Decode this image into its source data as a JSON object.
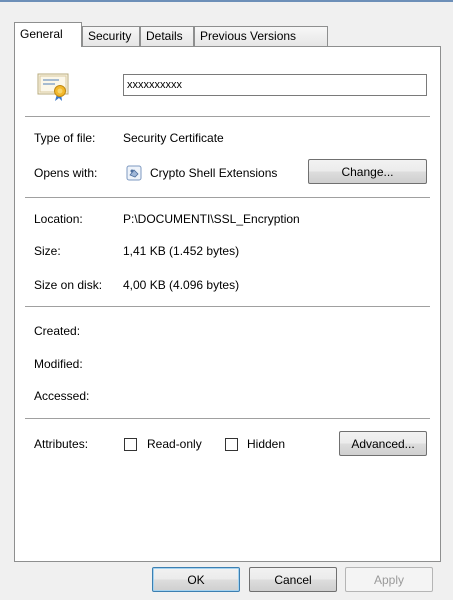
{
  "tabs": [
    {
      "label": "General"
    },
    {
      "label": "Security"
    },
    {
      "label": "Details"
    },
    {
      "label": "Previous Versions"
    }
  ],
  "file_name": "xxxxxxxxxx",
  "type_of_file": {
    "label": "Type of file:",
    "value": "Security Certificate"
  },
  "opens_with": {
    "label": "Opens with:",
    "value": "Crypto Shell Extensions",
    "button": "Change..."
  },
  "location": {
    "label": "Location:",
    "value": "P:\\DOCUMENTI\\SSL_Encryption"
  },
  "size": {
    "label": "Size:",
    "value": "1,41 KB (1.452 bytes)"
  },
  "size_on_disk": {
    "label": "Size on disk:",
    "value": "4,00 KB (4.096 bytes)"
  },
  "created": {
    "label": "Created:",
    "value": ""
  },
  "modified": {
    "label": "Modified:",
    "value": ""
  },
  "accessed": {
    "label": "Accessed:",
    "value": ""
  },
  "attributes": {
    "label": "Attributes:",
    "read_only": {
      "label": "Read-only",
      "checked": false
    },
    "hidden": {
      "label": "Hidden",
      "checked": false
    },
    "advanced_button": "Advanced..."
  },
  "footer": {
    "ok": "OK",
    "cancel": "Cancel",
    "apply": "Apply"
  },
  "icons": {
    "file_icon": "certificate-icon",
    "opens_with_icon": "crypto-shell-icon"
  }
}
